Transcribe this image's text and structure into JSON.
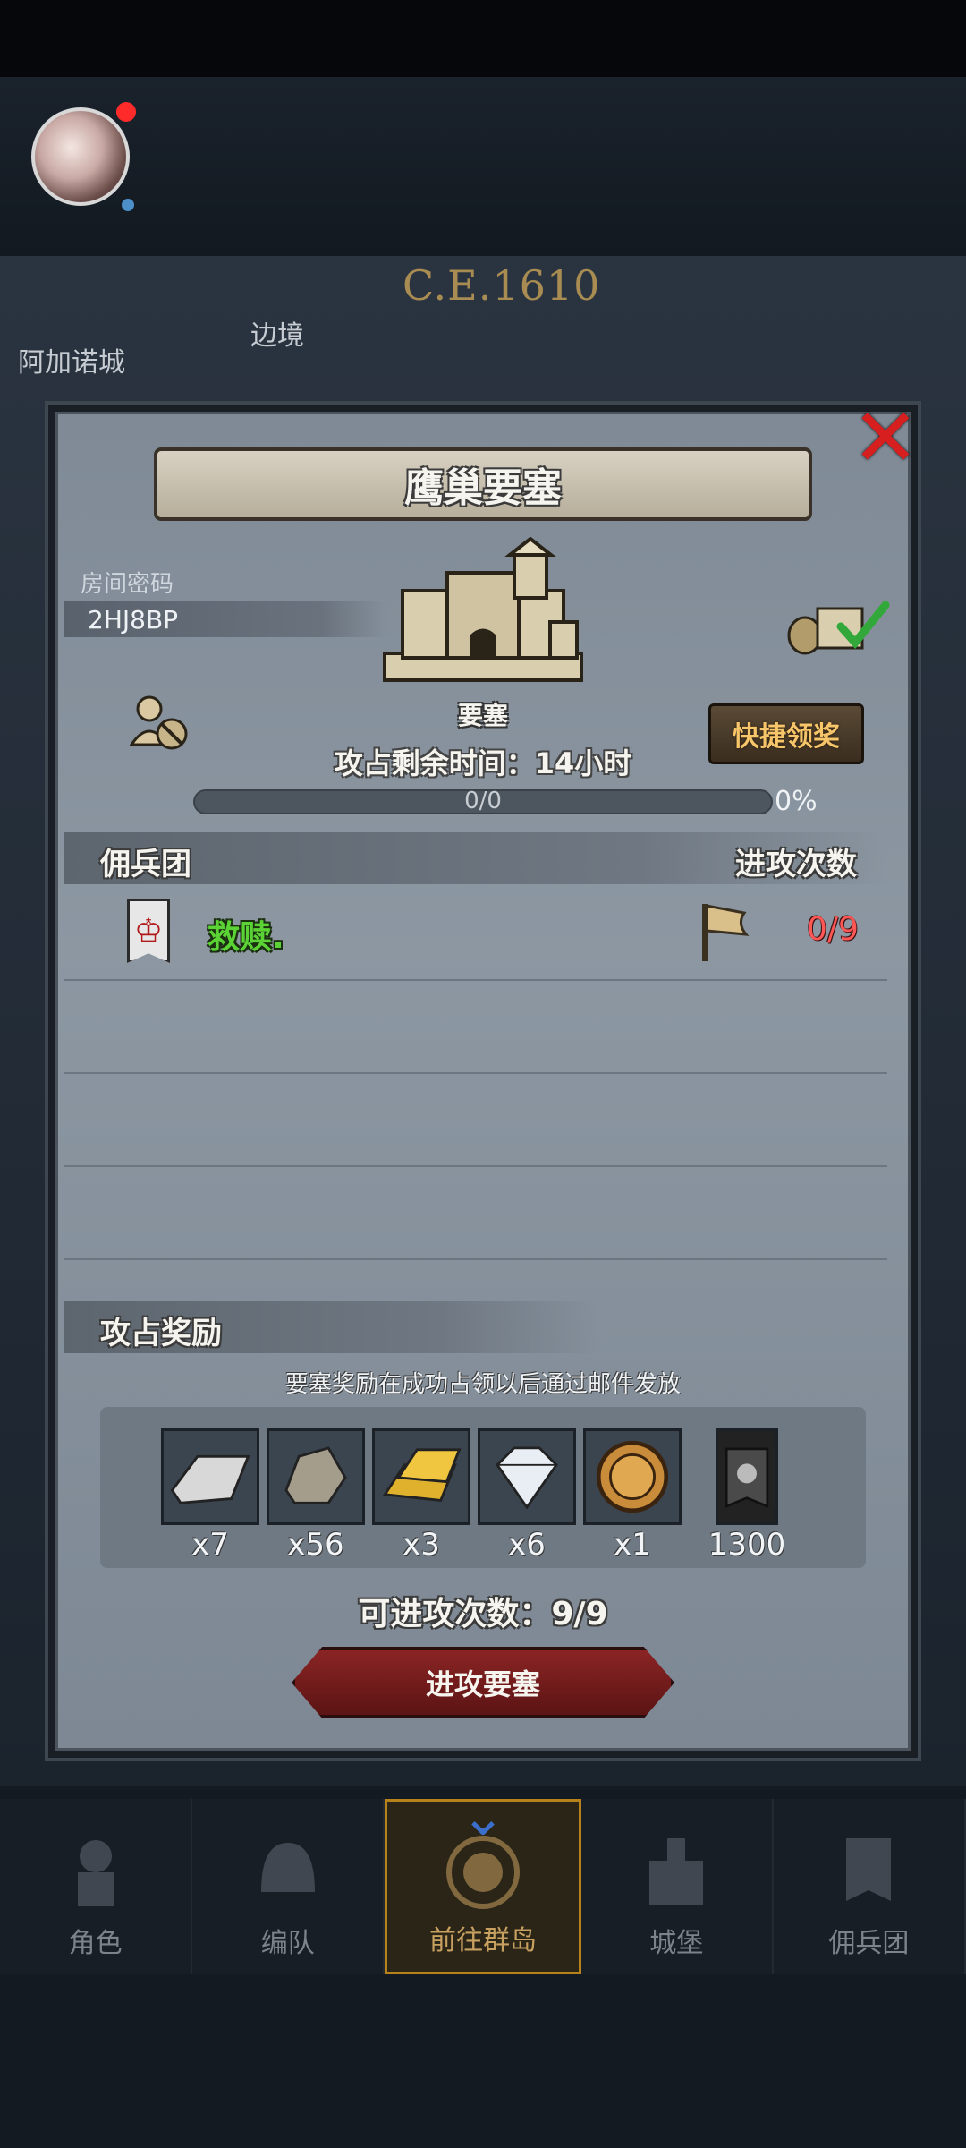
{
  "map": {
    "year_label": "C.E.1610",
    "left_text": "阿加诺城",
    "left_text2": "边境"
  },
  "dialog": {
    "title": "鹰巢要塞",
    "room_label": "房间密码",
    "room_code": "2HJ8BP",
    "castle_label": "要塞",
    "time_remaining": "攻占剩余时间：14小时",
    "quick_claim": "快捷领奖",
    "progress_text": "0/0",
    "progress_percent": "0%",
    "progress_value": 0
  },
  "mercenary_section": {
    "title": "佣兵团",
    "attack_header": "进攻次数",
    "rows": [
      {
        "name": "救赎.",
        "attacks": "0/9"
      }
    ]
  },
  "reward_section": {
    "title": "攻占奖励",
    "note": "要塞奖励在成功占领以后通过邮件发放",
    "items": [
      {
        "icon": "iron-ingot-icon",
        "qty": "x7"
      },
      {
        "icon": "stone-icon",
        "qty": "x56"
      },
      {
        "icon": "gold-bar-icon",
        "qty": "x3"
      },
      {
        "icon": "diamond-icon",
        "qty": "x6"
      },
      {
        "icon": "knight-medal-icon",
        "qty": "x1"
      },
      {
        "icon": "mercenary-banner-icon",
        "qty": "1300"
      }
    ]
  },
  "attacks_left": "可进攻次数：9/9",
  "attack_button": "进攻要塞",
  "nav": [
    {
      "label": "角色",
      "icon": "knight-icon"
    },
    {
      "label": "编队",
      "icon": "helmet-icon"
    },
    {
      "label": "前往群岛",
      "icon": "compass-icon",
      "active": true
    },
    {
      "label": "城堡",
      "icon": "castle-icon"
    },
    {
      "label": "佣兵团",
      "icon": "banner-icon"
    }
  ],
  "colors": {
    "accent_green": "#5bd235",
    "accent_red": "#ff5656",
    "close_red": "#d81f1f",
    "gold": "#f7c66a"
  }
}
